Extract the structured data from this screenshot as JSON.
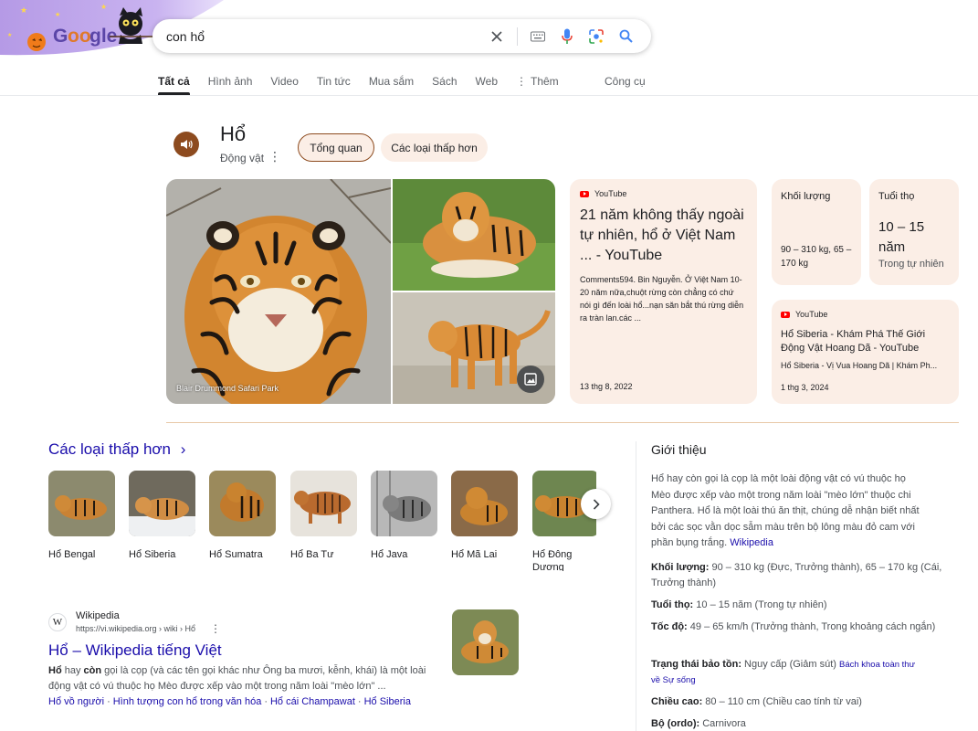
{
  "search": {
    "query": "con hổ",
    "logo_text": "Google"
  },
  "tabs": [
    {
      "label": "Tất cả",
      "active": true
    },
    {
      "label": "Hình ảnh"
    },
    {
      "label": "Video"
    },
    {
      "label": "Tin tức"
    },
    {
      "label": "Mua sắm"
    },
    {
      "label": "Sách"
    },
    {
      "label": "Web"
    },
    {
      "label": "Thêm"
    }
  ],
  "tools_label": "Công cụ",
  "entity": {
    "title": "Hổ",
    "subtitle": "Động vật",
    "chips": [
      "Tổng quan",
      "Các loại thấp hơn"
    ]
  },
  "images": {
    "credit": "Blair Drummond Safari Park"
  },
  "card_video_1": {
    "source": "YouTube",
    "title": "21 năm không thấy ngoài tự nhiên, hổ ở Việt Nam ... - YouTube",
    "description": "Comments594. Bin Nguyễn. Ở Việt Nam 10-20 năm nữa,chuột rừng còn chẳng có chứ nói gì đến loài hổ...nạn săn bắt thú rừng diễn ra tràn lan.các ...",
    "date": "13 thg 8, 2022"
  },
  "card_weight": {
    "label": "Khối lượng",
    "value": "90 – 310 kg, 65 – 170 kg"
  },
  "card_lifespan": {
    "label": "Tuổi thọ",
    "value": "10 – 15 năm",
    "note": "Trong tự nhiên"
  },
  "card_video_2": {
    "source": "YouTube",
    "title": "Hổ Siberia - Khám Phá Thế Giới Động Vật Hoang Dã - YouTube",
    "description": "Hổ Siberia - Vị Vua Hoang Dã | Khám Ph...",
    "date": "1 thg 3, 2024"
  },
  "similar": {
    "title": "Các loại thấp hơn",
    "items": [
      {
        "label": "Hổ Bengal"
      },
      {
        "label": "Hổ Siberia"
      },
      {
        "label": "Hổ Sumatra"
      },
      {
        "label": "Hổ Ba Tư"
      },
      {
        "label": "Hổ Java"
      },
      {
        "label": "Hổ Mã Lai"
      },
      {
        "label": "Hổ Đông Dương"
      }
    ]
  },
  "wiki_result": {
    "site": "Wikipedia",
    "url": "https://vi.wikipedia.org › wiki › Hổ",
    "title": "Hổ – Wikipedia tiếng Việt",
    "snippet_bold_1": "Hổ",
    "snippet_1": " hay ",
    "snippet_bold_2": "còn",
    "snippet_2": " gọi là cọp (và các tên gọi khác như Ông ba mươi, kễnh, khái) là một loài động vật có vú thuộc họ Mèo được xếp vào một trong năm loài \"mèo lớn\" ...",
    "sitelinks": [
      "Hổ vồ người",
      "Hình tượng con hổ trong văn hóa",
      "Hổ cái Champawat",
      "Hổ Siberia"
    ]
  },
  "knowledge_panel": {
    "title": "Giới thiệu",
    "description": "Hổ hay còn gọi là cọp là một loài động vật có vú thuộc họ Mèo được xếp vào một trong năm loài \"mèo lớn\" thuộc chi Panthera. Hổ là một loài thú ăn thịt, chúng dễ nhận biết nhất bởi các sọc vằn dọc sẫm màu trên bộ lông màu đỏ cam với phần bụng trắng.",
    "source": "Wikipedia",
    "facts": [
      {
        "key": "Khối lượng:",
        "value": " 90 – 310 kg (Đực, Trưởng thành), 65 – 170 kg (Cái, Trưởng thành)"
      },
      {
        "key": "Tuổi thọ:",
        "value": " 10 – 15 năm (Trong tự nhiên)"
      },
      {
        "key": "Tốc độ:",
        "value": " 49 – 65 km/h (Trưởng thành, Trong khoảng cách ngắn)"
      },
      {
        "key": "Trạng thái bảo tồn:",
        "value": " Nguy cấp (Giảm sút) ",
        "link": "Bách khoa toàn thư về Sự sống"
      },
      {
        "key": "Chiều cao:",
        "value": " 80 – 110 cm (Chiều cao tính từ vai)"
      },
      {
        "key": "Bộ (ordo):",
        "value": " Carnivora"
      }
    ]
  },
  "colors": {
    "accent_brown": "#8d4b1f",
    "card_bg": "#fbeee6",
    "link_blue": "#1a0dab",
    "doodle_purple": "#b89be8"
  }
}
